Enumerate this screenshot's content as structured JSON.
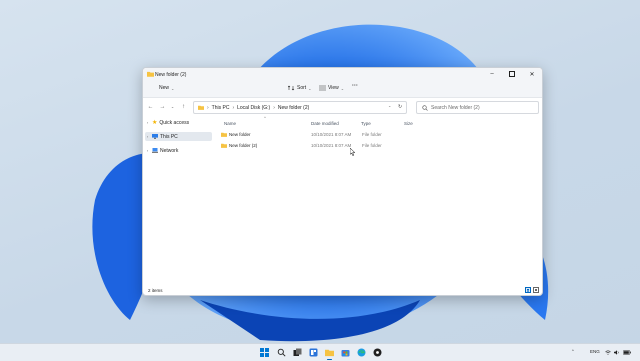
{
  "window": {
    "title": "New folder (2)",
    "minimize_icon": "minimize-icon",
    "maximize_icon": "maximize-icon",
    "close_icon": "close-icon"
  },
  "toolbar": {
    "new_label": "New",
    "sort_label": "Sort",
    "view_label": "View",
    "more_label": "···"
  },
  "address_bar": {
    "crumbs": [
      "This PC",
      "Local Disk (G:)",
      "New folder (2)"
    ],
    "search_placeholder": "Search New folder (2)"
  },
  "sidebar": {
    "items": [
      {
        "label": "Quick access",
        "icon": "star-icon"
      },
      {
        "label": "This PC",
        "icon": "pc-icon"
      },
      {
        "label": "Network",
        "icon": "network-icon"
      }
    ]
  },
  "file_list": {
    "columns": [
      "Name",
      "Date modified",
      "Type",
      "Size"
    ],
    "rows": [
      {
        "name": "New folder",
        "date": "10/10/2021 8:07 AM",
        "type": "File folder",
        "size": ""
      },
      {
        "name": "New folder (2)",
        "date": "10/10/2021 8:07 AM",
        "type": "File folder",
        "size": ""
      }
    ]
  },
  "status_bar": {
    "item_count": "2 items"
  },
  "taskbar": {
    "language": "ENG"
  },
  "colors": {
    "accent": "#0067c0",
    "folder": "#f6c343",
    "wallpaper_blue": "#1a5fd6"
  }
}
